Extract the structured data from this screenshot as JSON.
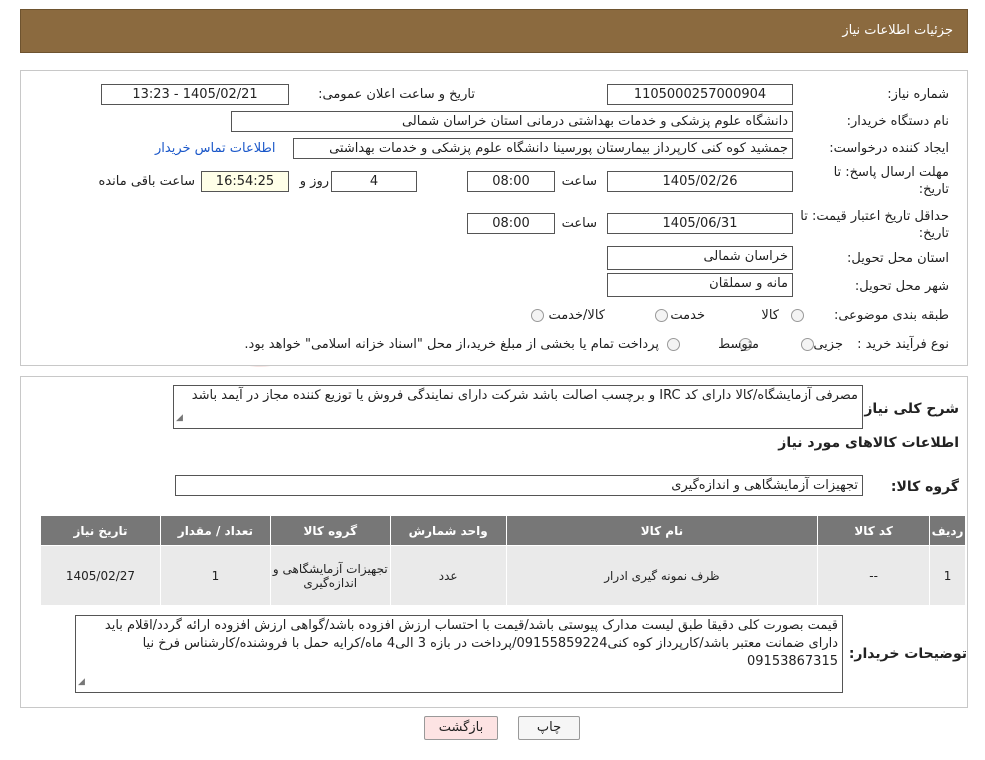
{
  "header": {
    "title": "جزئیات اطلاعات نیاز"
  },
  "form": {
    "need_number_label": "شماره نیاز:",
    "need_number": "1105000257000904",
    "announce_label": "تاریخ و ساعت اعلان عمومی:",
    "announce_value": "1405/02/21 - 13:23",
    "buyer_label": "نام دستگاه خریدار:",
    "buyer_value": "دانشگاه علوم پزشکی و خدمات بهداشتی درمانی استان خراسان شمالی",
    "creator_label": "ایجاد کننده درخواست:",
    "creator_value": "جمشید کوه کنی کارپرداز بیمارستان پورسینا دانشگاه علوم پزشکی و خدمات بهداشتی",
    "contact_link": "اطلاعات تماس خریدار",
    "deadline_label": "مهلت ارسال پاسخ: تا تاریخ:",
    "deadline_date": "1405/02/26",
    "time_label": "ساعت",
    "deadline_time": "08:00",
    "days_value": "4",
    "days_label": "روز و",
    "remaining_time": "16:54:25",
    "remaining_label": "ساعت باقی مانده",
    "validity_label": "حداقل تاریخ اعتبار قیمت: تا تاریخ:",
    "validity_date": "1405/06/31",
    "validity_time": "08:00",
    "province_label": "استان محل تحویل:",
    "province_value": "خراسان شمالی",
    "city_label": "شهر محل تحویل:",
    "city_value": "مانه و سملقان",
    "category_label": "طبقه بندی موضوعی:",
    "category_options": [
      "کالا",
      "خدمت",
      "کالا/خدمت"
    ],
    "process_label": "نوع فرآیند خرید :",
    "process_options": [
      "جزیی",
      "متوسط"
    ],
    "process_note": "پرداخت تمام یا بخشی از مبلغ خرید،از محل \"اسناد خزانه اسلامی\" خواهد بود."
  },
  "details": {
    "summary_label": "شرح کلی نیاز:",
    "summary_value": "مصرفی آزمایشگاه/کالا دارای کد IRC و برچسب اصالت باشد شرکت دارای نمایندگی فروش یا توزیع کننده  مجاز در آیمد باشد",
    "items_title": "اطلاعات کالاهای مورد نیاز",
    "group_label": "گروه کالا:",
    "group_value": "تجهیزات آزمایشگاهی و اندازه‌گیری",
    "columns": [
      "ردیف",
      "کد کالا",
      "نام کالا",
      "واحد شمارش",
      "گروه کالا",
      "تعداد / مقدار",
      "تاریخ نیاز"
    ],
    "rows": [
      [
        "1",
        "--",
        "ظرف نمونه گیری ادرار",
        "عدد",
        "تجهیزات آزمایشگاهی و اندازه‌گیری",
        "1",
        "1405/02/27"
      ]
    ],
    "notes_label": "توضیحات خریدار:",
    "notes_value": "قیمت بصورت کلی دقیقا طبق لیست مدارک پیوستی باشد/قیمت با احتساب ارزش افزوده باشد/گواهی ارزش افزوده ارائه گردد/اقلام باید دارای ضمانت معتبر باشد/کارپرداز کوه کنی09155859224/پرداخت در بازه 3 الی4 ماه/کرایه حمل با فروشنده/کارشناس فرخ نیا 09153867315"
  },
  "buttons": {
    "print": "چاپ",
    "back": "بازگشت"
  },
  "colors": {
    "header_bg": "#8b6a3f",
    "table_header_bg": "#777777",
    "link": "#1a57c9",
    "back_button_bg": "#fde3e3"
  }
}
